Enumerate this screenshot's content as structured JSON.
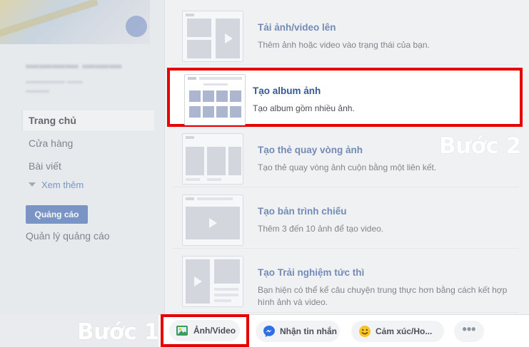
{
  "left_nav": {
    "items": [
      {
        "label": "Trang chủ",
        "active": true
      },
      {
        "label": "Cửa hàng",
        "active": false
      },
      {
        "label": "Bài viết",
        "active": false
      }
    ],
    "see_more": "Xem thêm",
    "ad_button": "Quảng cáo",
    "ad_manage": "Quản lý quảng cáo"
  },
  "menu": {
    "items": [
      {
        "title": "Tải ảnh/video lên",
        "desc": "Thêm ảnh hoặc video vào trạng thái của bạn."
      },
      {
        "title": "Tạo album ảnh",
        "desc": "Tạo album gồm nhiều ảnh."
      },
      {
        "title": "Tạo thẻ quay vòng ảnh",
        "desc": "Tạo thẻ quay vòng ảnh cuộn bằng một liên kết."
      },
      {
        "title": "Tạo bản trình chiếu",
        "desc": "Thêm 3 đến 10 ảnh để tạo video."
      },
      {
        "title": "Tạo Trải nghiệm tức thì",
        "desc": "Bạn hiện có thể kể câu chuyện trung thực hơn bằng cách kết hợp hình ảnh và video."
      }
    ]
  },
  "steps": {
    "step1": "Bước 1",
    "step2": "Bước 2"
  },
  "composer_bar": {
    "photo_video": "Ảnh/Video",
    "message": "Nhận tin nhắn",
    "feeling": "Cảm xúc/Ho...",
    "more": "•••"
  },
  "colors": {
    "highlight_border": "#e60000",
    "link_blue": "#365899",
    "button_blue": "#4267b2"
  }
}
